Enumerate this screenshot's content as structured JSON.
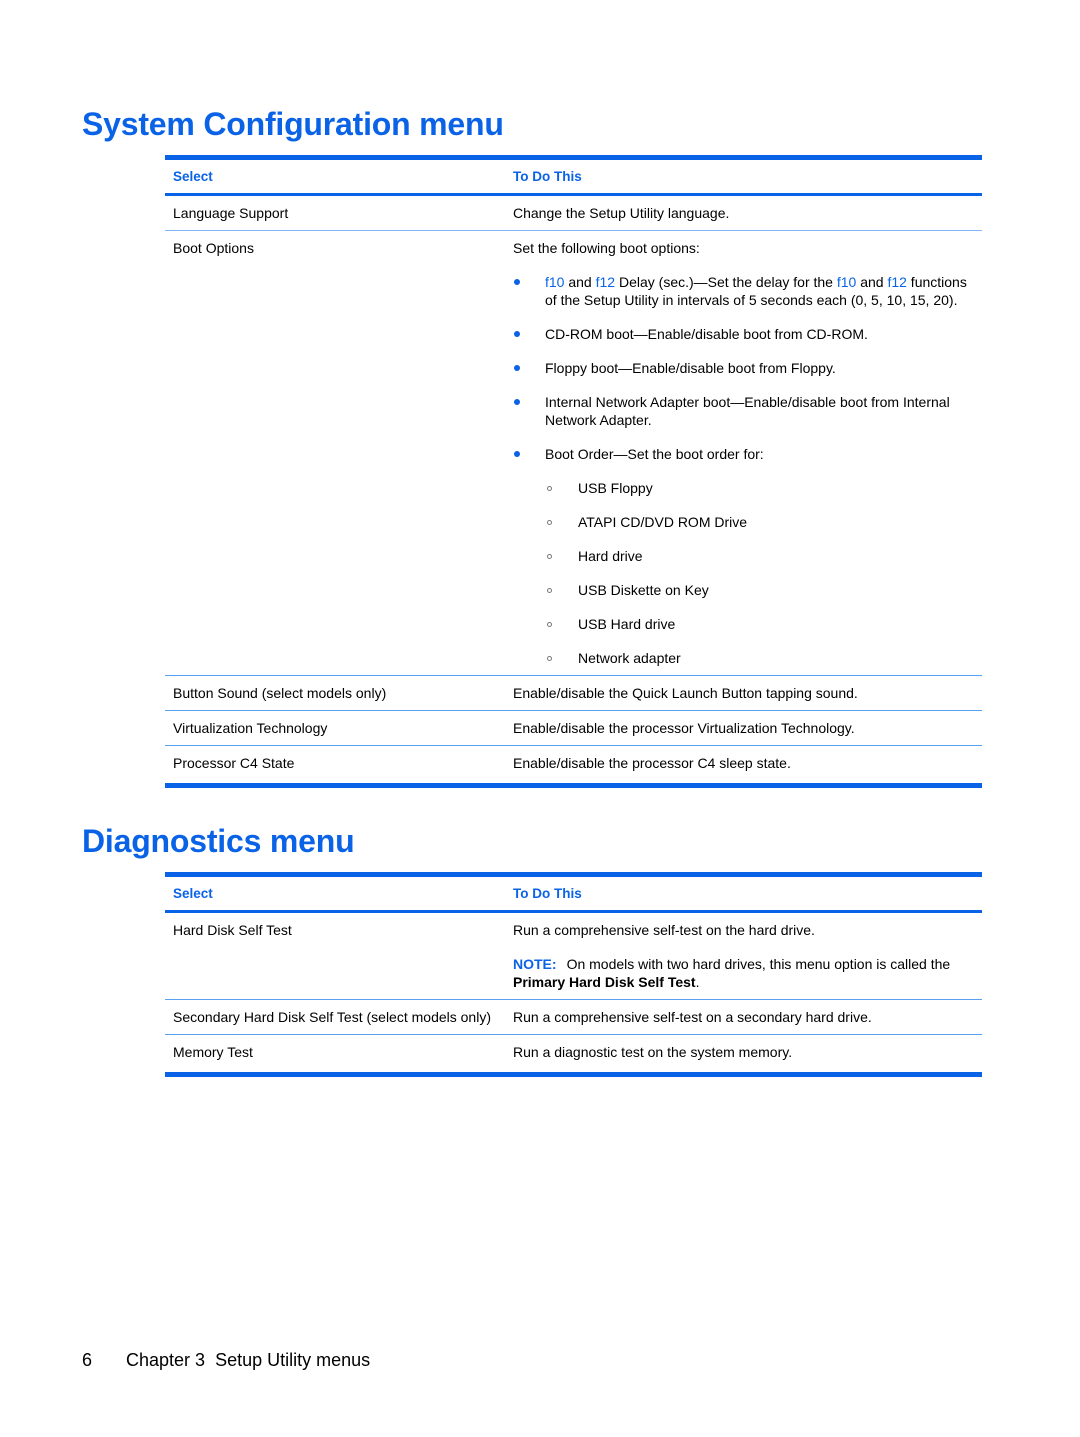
{
  "system_config": {
    "title": "System Configuration menu",
    "headers": {
      "select": "Select",
      "todo": "To Do This"
    },
    "rows": {
      "language": {
        "select": "Language Support",
        "todo": "Change the Setup Utility language."
      },
      "boot": {
        "select": "Boot Options",
        "intro": "Set the following boot options:",
        "delay": {
          "k1": "f10",
          "t1": " and ",
          "k2": "f12",
          "t2": " Delay (sec.)—Set the delay for the ",
          "k3": "f10",
          "t3": " and ",
          "k4": "f12",
          "t4": " functions of the Setup Utility in intervals of 5 seconds each (0, 5, 10, 15, 20)."
        },
        "bullets": [
          "CD-ROM boot—Enable/disable boot from CD-ROM.",
          "Floppy boot—Enable/disable boot from Floppy.",
          "Internal Network Adapter boot—Enable/disable boot from Internal Network Adapter.",
          "Boot Order—Set the boot order for:"
        ],
        "boot_order": [
          "USB Floppy",
          "ATAPI CD/DVD ROM Drive",
          "Hard drive",
          "USB Diskette on Key",
          "USB Hard drive",
          "Network adapter"
        ]
      },
      "button_sound": {
        "select": "Button Sound (select models only)",
        "todo": "Enable/disable the Quick Launch Button tapping sound."
      },
      "virtualization": {
        "select": "Virtualization Technology",
        "todo": "Enable/disable the processor Virtualization Technology."
      },
      "c4": {
        "select": "Processor C4 State",
        "todo": "Enable/disable the processor C4 sleep state."
      }
    }
  },
  "diagnostics": {
    "title": "Diagnostics menu",
    "headers": {
      "select": "Select",
      "todo": "To Do This"
    },
    "rows": {
      "hdd": {
        "select": "Hard Disk Self Test",
        "todo": "Run a comprehensive self-test on the hard drive.",
        "note_label": "NOTE:",
        "note_text": "On models with two hard drives, this menu option is called the ",
        "note_bold": "Primary Hard Disk Self Test",
        "note_end": "."
      },
      "secondary": {
        "select": "Secondary Hard Disk Self Test (select models only)",
        "todo": "Run a comprehensive self-test on a secondary hard drive."
      },
      "memory": {
        "select": "Memory Test",
        "todo": "Run a diagnostic test on the system memory."
      }
    }
  },
  "footer": {
    "page_number": "6",
    "chapter": "Chapter 3",
    "chapter_title": "Setup Utility menus"
  }
}
